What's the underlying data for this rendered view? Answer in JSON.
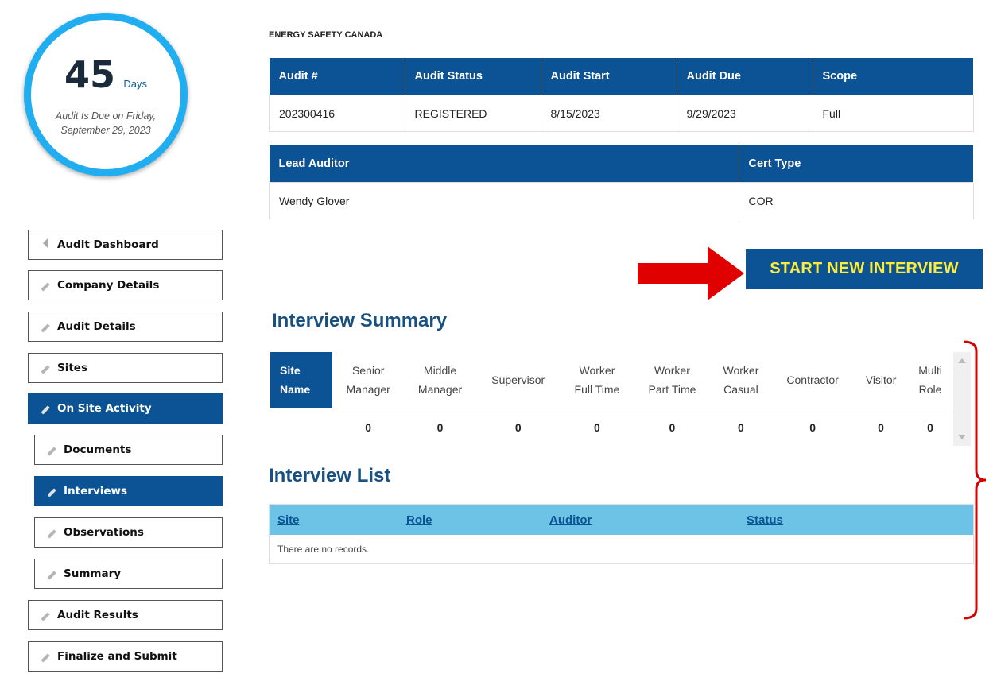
{
  "countdown": {
    "days_number": "45",
    "days_label": "Days",
    "due_line1": "Audit Is Due on Friday,",
    "due_line2": "September 29, 2023"
  },
  "sidebar": {
    "items": [
      {
        "label": "Audit Dashboard",
        "icon": "triangle-left-icon",
        "active": false
      },
      {
        "label": "Company Details",
        "icon": "pencil-icon",
        "active": false
      },
      {
        "label": "Audit Details",
        "icon": "pencil-icon",
        "active": false
      },
      {
        "label": "Sites",
        "icon": "pencil-icon",
        "active": false
      },
      {
        "label": "On Site Activity",
        "icon": "pencil-icon",
        "active": true
      },
      {
        "label": "Documents",
        "icon": "pencil-icon",
        "active": false
      },
      {
        "label": "Interviews",
        "icon": "pencil-icon",
        "active": true
      },
      {
        "label": "Observations",
        "icon": "pencil-icon",
        "active": false
      },
      {
        "label": "Summary",
        "icon": "pencil-icon",
        "active": false
      },
      {
        "label": "Audit Results",
        "icon": "pencil-icon",
        "active": false
      },
      {
        "label": "Finalize and Submit",
        "icon": "pencil-icon",
        "active": false
      }
    ]
  },
  "org_name": "ENERGY SAFETY CANADA",
  "audit_table": {
    "headers": [
      "Audit #",
      "Audit Status",
      "Audit Start",
      "Audit Due",
      "Scope"
    ],
    "row": [
      "202300416",
      "REGISTERED",
      "8/15/2023",
      "9/29/2023",
      "Full"
    ]
  },
  "auditor_table": {
    "headers": [
      "Lead Auditor",
      "Cert Type"
    ],
    "row": [
      "Wendy Glover",
      "COR"
    ]
  },
  "start_button_label": "START NEW INTERVIEW",
  "interview_summary": {
    "title": "Interview Summary",
    "headers": [
      {
        "line1": "Site",
        "line2": "Name"
      },
      {
        "line1": "Senior",
        "line2": "Manager"
      },
      {
        "line1": "Middle",
        "line2": "Manager"
      },
      {
        "line1": "Supervisor",
        "line2": ""
      },
      {
        "line1": "Worker",
        "line2": "Full Time"
      },
      {
        "line1": "Worker",
        "line2": "Part Time"
      },
      {
        "line1": "Worker",
        "line2": "Casual"
      },
      {
        "line1": "Contractor",
        "line2": ""
      },
      {
        "line1": "Visitor",
        "line2": ""
      },
      {
        "line1": "Multi",
        "line2": "Role"
      }
    ],
    "row": [
      "",
      "0",
      "0",
      "0",
      "0",
      "0",
      "0",
      "0",
      "0",
      "0"
    ]
  },
  "interview_list": {
    "title": "Interview List",
    "headers": [
      "Site",
      "Role",
      "Auditor",
      "Status"
    ],
    "empty_text": "There are no records."
  },
  "colors": {
    "primary": "#0b5394",
    "accent_yellow": "#ffeb3b",
    "circle_blue": "#21aef0",
    "list_header": "#6cc3e6",
    "annotation_red": "#e00000"
  }
}
